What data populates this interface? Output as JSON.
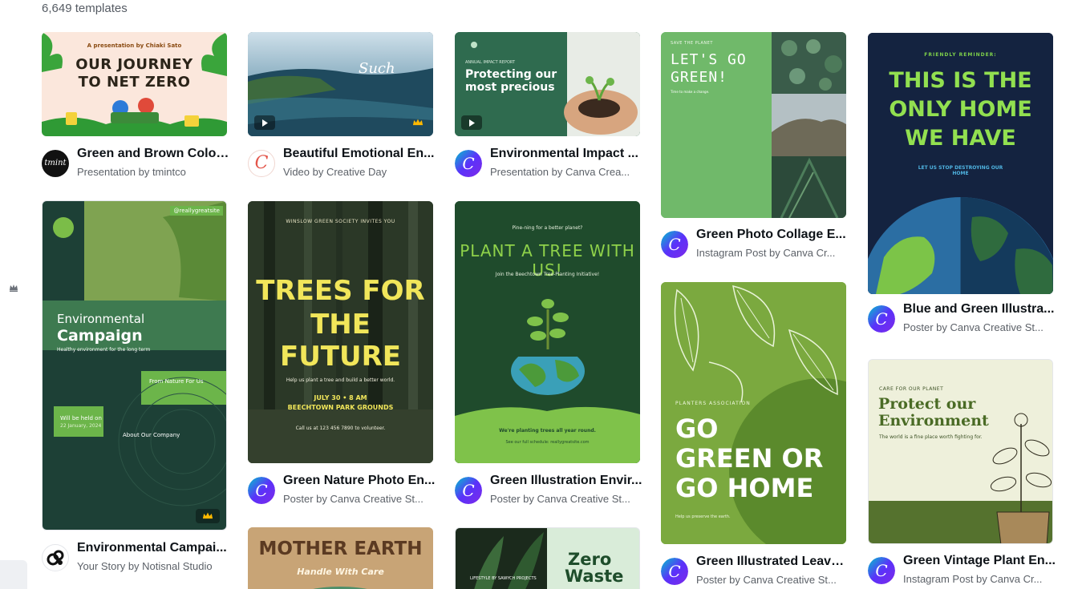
{
  "header": {
    "template_count": "6,649 templates"
  },
  "cards": [
    {
      "title": "Green and Brown Color...",
      "subtitle": "Presentation by tmintco",
      "preview": {
        "kicker": "A presentation by Chiaki Sato",
        "headline_1": "OUR JOURNEY",
        "headline_2": "TO NET ZERO"
      },
      "avatar_icon": "tmint-logo",
      "avatar_text": "tmint"
    },
    {
      "title": "Beautiful Emotional En...",
      "subtitle": "Video by Creative Day",
      "preview": {
        "script_text": "Such"
      },
      "avatar_icon": "creative-day-logo",
      "avatar_text": "C"
    },
    {
      "title": "Environmental Impact ...",
      "subtitle": "Presentation by Canva Crea...",
      "preview": {
        "kicker": "ANNUAL IMPACT REPORT",
        "headline_1": "Protecting our",
        "headline_2": "most precious"
      },
      "avatar_icon": "canva-logo",
      "avatar_text": "C"
    },
    {
      "title": "Green Photo Collage E...",
      "subtitle": "Instagram Post by Canva Cr...",
      "preview": {
        "kicker": "SAVE THE PLANET",
        "headline_1": "LET'S GO",
        "headline_2": "GREEN!",
        "small": "Time to make a change."
      },
      "avatar_icon": "canva-logo",
      "avatar_text": "C"
    },
    {
      "title": "Blue and Green Illustra...",
      "subtitle": "Poster by Canva Creative St...",
      "preview": {
        "kicker": "FRIENDLY REMINDER:",
        "headline_1": "THIS IS THE",
        "headline_2": "ONLY HOME",
        "headline_3": "WE HAVE",
        "small": "LET US STOP DESTROYING OUR HOME"
      },
      "avatar_icon": "canva-logo",
      "avatar_text": "C"
    },
    {
      "title": "Environmental Campai...",
      "subtitle": "Your Story by Notisnal Studio",
      "preview": {
        "handle": "@reallygreatsite",
        "headline_1": "Environmental",
        "headline_2": "Campaign",
        "tagline": "Healthy environment for the long term",
        "box_title": "From Nature For Us",
        "held_on": "Will be held on",
        "date": "22 January, 2024",
        "about": "About Our Company"
      },
      "avatar_icon": "notisnal-logo",
      "avatar_text": "N"
    },
    {
      "title": "Green Nature Photo En...",
      "subtitle": "Poster by Canva Creative St...",
      "preview": {
        "kicker": "WINSLOW GREEN SOCIETY INVITES YOU",
        "headline_1": "TREES FOR",
        "headline_2": "THE FUTURE",
        "small": "Help us plant a tree and build a better world.",
        "when": "JULY 30 • 8 AM",
        "where": "BEECHTOWN PARK GROUNDS",
        "call": "Call us at 123 456 7890 to volunteer."
      },
      "avatar_icon": "canva-logo",
      "avatar_text": "C"
    },
    {
      "title": "Green Illustration Envir...",
      "subtitle": "Poster by Canva Creative St...",
      "preview": {
        "kicker": "Pine-ning for a better planet?",
        "headline_1": "PLANT A TREE WITH US!",
        "small": "Join the Beechtown Tree-Planting Initiative!",
        "footer_1": "We're planting trees all year round.",
        "footer_2": "See our full schedule: reallygreatsite.com"
      },
      "avatar_icon": "canva-logo",
      "avatar_text": "C"
    },
    {
      "title": "Green Illustrated Leave...",
      "subtitle": "Poster by Canva Creative St...",
      "preview": {
        "kicker": "PLANTERS ASSOCIATION",
        "headline_1": "GO",
        "headline_2": "GREEN OR",
        "headline_3": "GO HOME",
        "small": "Help us preserve the earth."
      },
      "avatar_icon": "canva-logo",
      "avatar_text": "C"
    },
    {
      "title": "Green Vintage Plant En...",
      "subtitle": "Instagram Post by Canva Cr...",
      "preview": {
        "kicker": "CARE FOR OUR PLANET",
        "headline_1": "Protect our",
        "headline_2": "Environment",
        "small": "The world is a fine place worth fighting for."
      },
      "avatar_icon": "canva-logo",
      "avatar_text": "C"
    },
    {
      "preview": {
        "headline_1": "MOTHER EARTH",
        "headline_2": "Handle With Care"
      }
    },
    {
      "preview": {
        "headline_1": "Zero",
        "headline_2": "Waste",
        "small": "LIFESTYLE BY SAWYCH PROJECTS"
      }
    }
  ],
  "colors": {
    "canva_teal": "#00c4cc",
    "canva_purple": "#7d2ae8",
    "premium_crown": "#ffb800"
  }
}
